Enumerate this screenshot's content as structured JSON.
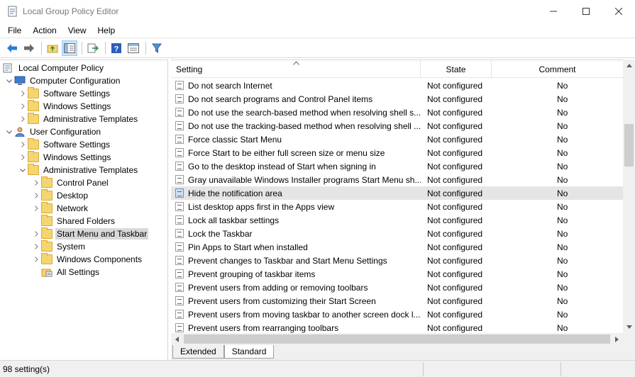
{
  "window": {
    "title": "Local Group Policy Editor",
    "minimize_glyph": "—",
    "maximize_glyph": "☐",
    "close_glyph": "✕"
  },
  "menu": [
    "File",
    "Action",
    "View",
    "Help"
  ],
  "tree": [
    {
      "label": "Local Computer Policy",
      "level": 0,
      "expander": "",
      "icon": "computer-policy-icon"
    },
    {
      "label": "Computer Configuration",
      "level": 0,
      "expander": "expanded",
      "icon": "computer-icon"
    },
    {
      "label": "Software Settings",
      "level": 1,
      "expander": "collapsed",
      "icon": "folder-icon"
    },
    {
      "label": "Windows Settings",
      "level": 1,
      "expander": "collapsed",
      "icon": "folder-icon"
    },
    {
      "label": "Administrative Templates",
      "level": 1,
      "expander": "collapsed",
      "icon": "folder-icon"
    },
    {
      "label": "User Configuration",
      "level": 0,
      "expander": "expanded",
      "icon": "user-icon"
    },
    {
      "label": "Software Settings",
      "level": 1,
      "expander": "collapsed",
      "icon": "folder-icon"
    },
    {
      "label": "Windows Settings",
      "level": 1,
      "expander": "collapsed",
      "icon": "folder-icon"
    },
    {
      "label": "Administrative Templates",
      "level": 1,
      "expander": "expanded",
      "icon": "folder-icon"
    },
    {
      "label": "Control Panel",
      "level": 2,
      "expander": "collapsed",
      "icon": "folder-icon"
    },
    {
      "label": "Desktop",
      "level": 2,
      "expander": "collapsed",
      "icon": "folder-icon"
    },
    {
      "label": "Network",
      "level": 2,
      "expander": "collapsed",
      "icon": "folder-icon"
    },
    {
      "label": "Shared Folders",
      "level": 2,
      "expander": "",
      "icon": "folder-icon"
    },
    {
      "label": "Start Menu and Taskbar",
      "level": 2,
      "expander": "collapsed",
      "icon": "folder-icon",
      "selected": true
    },
    {
      "label": "System",
      "level": 2,
      "expander": "collapsed",
      "icon": "folder-icon"
    },
    {
      "label": "Windows Components",
      "level": 2,
      "expander": "collapsed",
      "icon": "folder-icon"
    },
    {
      "label": "All Settings",
      "level": 2,
      "expander": "",
      "icon": "all-settings-icon"
    }
  ],
  "columns": {
    "setting": "Setting",
    "state": "State",
    "comment": "Comment"
  },
  "rows": [
    {
      "setting": "Do not search Internet",
      "state": "Not configured",
      "comment": "No"
    },
    {
      "setting": "Do not search programs and Control Panel items",
      "state": "Not configured",
      "comment": "No"
    },
    {
      "setting": "Do not use the search-based method when resolving shell s...",
      "state": "Not configured",
      "comment": "No"
    },
    {
      "setting": "Do not use the tracking-based method when resolving shell ...",
      "state": "Not configured",
      "comment": "No"
    },
    {
      "setting": "Force classic Start Menu",
      "state": "Not configured",
      "comment": "No"
    },
    {
      "setting": "Force Start to be either full screen size or menu size",
      "state": "Not configured",
      "comment": "No"
    },
    {
      "setting": "Go to the desktop instead of Start when signing in",
      "state": "Not configured",
      "comment": "No"
    },
    {
      "setting": "Gray unavailable Windows Installer programs Start Menu sh...",
      "state": "Not configured",
      "comment": "No"
    },
    {
      "setting": "Hide the notification area",
      "state": "Not configured",
      "comment": "No",
      "highlighted": true
    },
    {
      "setting": "List desktop apps first in the Apps view",
      "state": "Not configured",
      "comment": "No"
    },
    {
      "setting": "Lock all taskbar settings",
      "state": "Not configured",
      "comment": "No"
    },
    {
      "setting": "Lock the Taskbar",
      "state": "Not configured",
      "comment": "No"
    },
    {
      "setting": "Pin Apps to Start when installed",
      "state": "Not configured",
      "comment": "No"
    },
    {
      "setting": "Prevent changes to Taskbar and Start Menu Settings",
      "state": "Not configured",
      "comment": "No"
    },
    {
      "setting": "Prevent grouping of taskbar items",
      "state": "Not configured",
      "comment": "No"
    },
    {
      "setting": "Prevent users from adding or removing toolbars",
      "state": "Not configured",
      "comment": "No"
    },
    {
      "setting": "Prevent users from customizing their Start Screen",
      "state": "Not configured",
      "comment": "No"
    },
    {
      "setting": "Prevent users from moving taskbar to another screen dock l...",
      "state": "Not configured",
      "comment": "No"
    },
    {
      "setting": "Prevent users from rearranging toolbars",
      "state": "Not configured",
      "comment": "No"
    }
  ],
  "tabs": [
    {
      "label": "Extended",
      "active": false
    },
    {
      "label": "Standard",
      "active": true
    }
  ],
  "status": {
    "text": "98 setting(s)"
  },
  "colors": {
    "selection": "#d9d9d9",
    "row_highlight": "#e5e5e5",
    "folder": "#f5d56f",
    "nav_arrow": "#1e6fc8"
  }
}
